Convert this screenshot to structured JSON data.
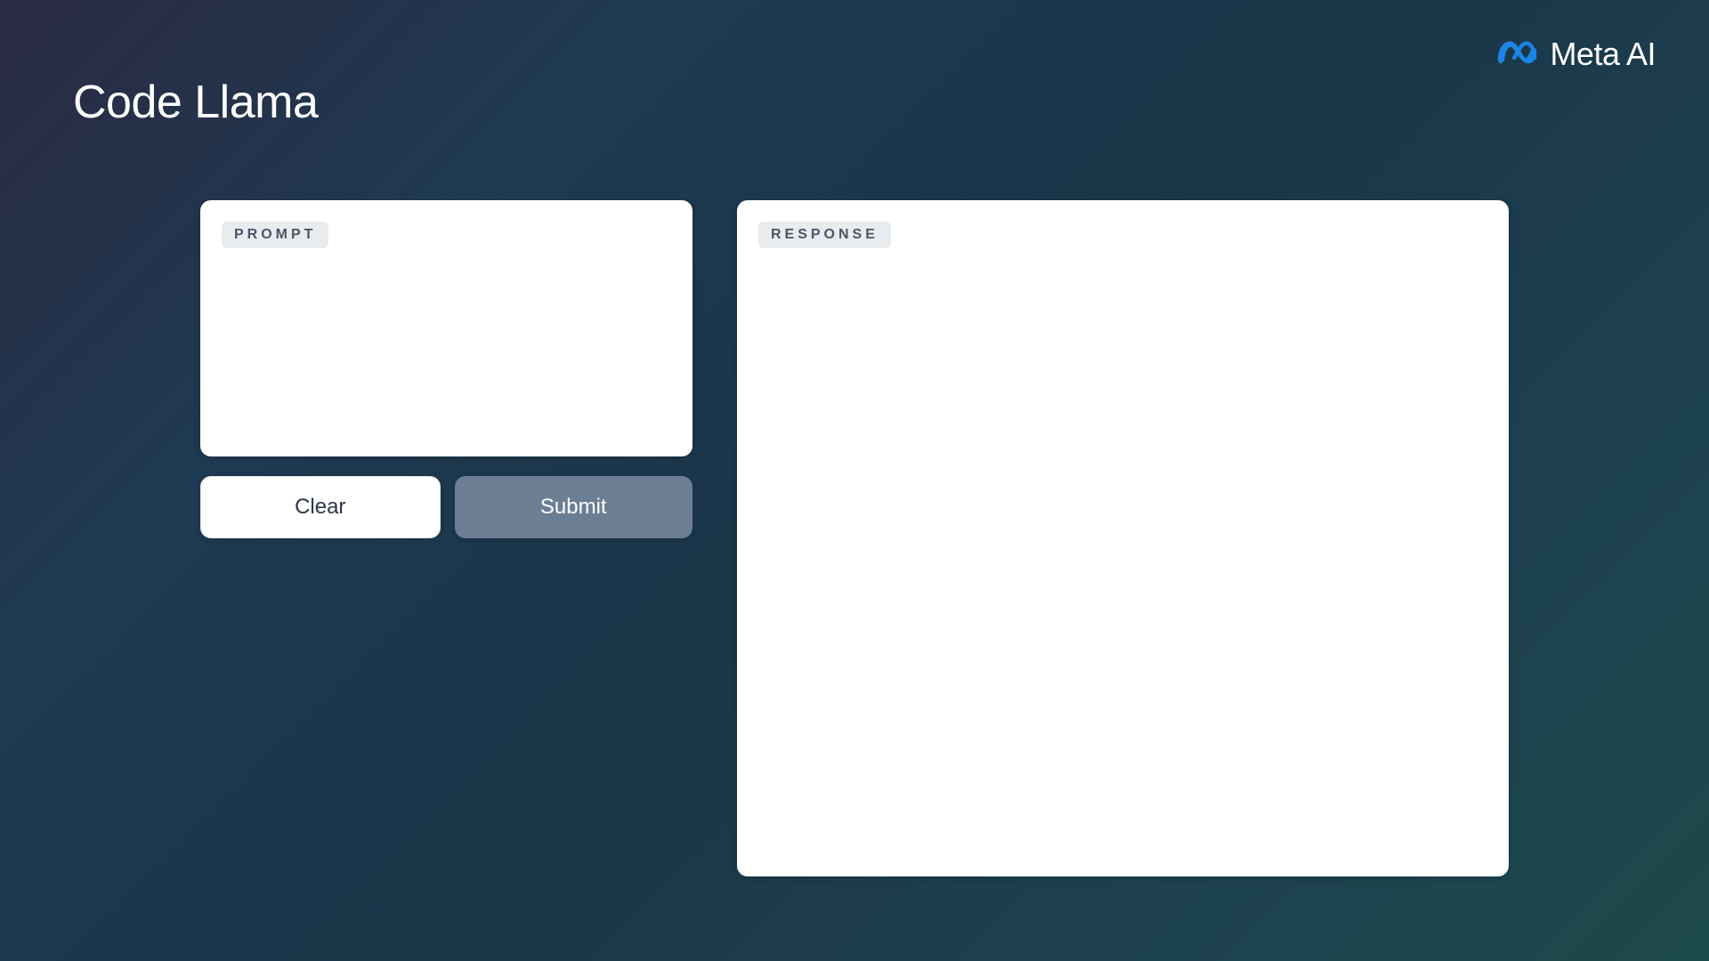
{
  "page": {
    "title": "Code Llama"
  },
  "brand": {
    "name": "Meta AI"
  },
  "prompt_panel": {
    "label": "PROMPT",
    "value": "",
    "placeholder": ""
  },
  "response_panel": {
    "label": "RESPONSE",
    "content": ""
  },
  "buttons": {
    "clear": "Clear",
    "submit": "Submit"
  }
}
